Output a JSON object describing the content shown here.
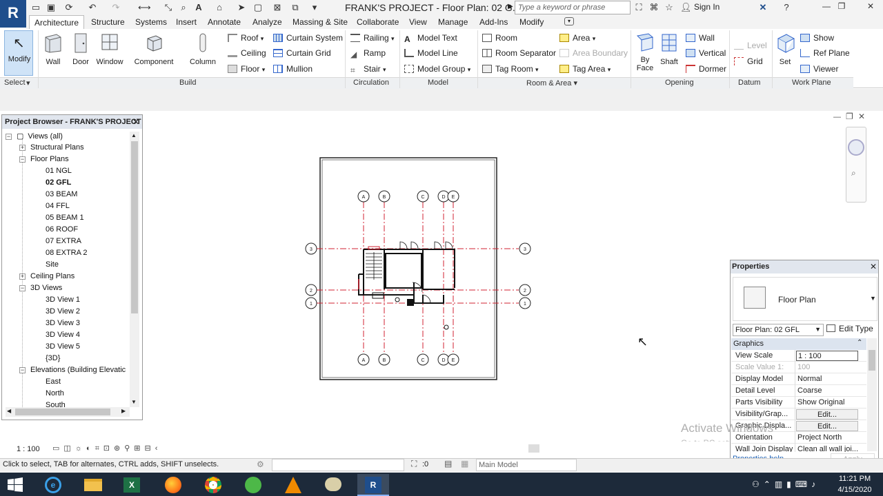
{
  "app": {
    "logo": "R",
    "doc_title": "FRANK'S PROJECT - Floor Plan: 02 G...",
    "search_placeholder": "Type a keyword or phrase",
    "sign_in": "Sign In"
  },
  "tabs": [
    "Architecture",
    "Structure",
    "Systems",
    "Insert",
    "Annotate",
    "Analyze",
    "Massing & Site",
    "Collaborate",
    "View",
    "Manage",
    "Add-Ins",
    "Modify"
  ],
  "ribbon": {
    "select": {
      "modify": "Modify",
      "panel": "Select"
    },
    "build": {
      "panel": "Build",
      "wall": "Wall",
      "door": "Door",
      "window": "Window",
      "component": "Component",
      "column": "Column",
      "roof": "Roof",
      "ceiling": "Ceiling",
      "floor": "Floor",
      "curtain_system": "Curtain System",
      "curtain_grid": "Curtain Grid",
      "mullion": "Mullion"
    },
    "circulation": {
      "panel": "Circulation",
      "railing": "Railing",
      "ramp": "Ramp",
      "stair": "Stair"
    },
    "model": {
      "panel": "Model",
      "model_text": "Model Text",
      "model_line": "Model Line",
      "model_group": "Model Group"
    },
    "room_area": {
      "panel": "Room & Area",
      "room": "Room",
      "room_separator": "Room Separator",
      "tag_room": "Tag Room",
      "area": "Area",
      "area_boundary": "Area Boundary",
      "tag_area": "Tag Area"
    },
    "opening": {
      "panel": "Opening",
      "by_face_1": "By",
      "by_face_2": "Face",
      "shaft": "Shaft",
      "wall": "Wall",
      "vertical": "Vertical",
      "dormer": "Dormer"
    },
    "datum": {
      "panel": "Datum",
      "level": "Level",
      "grid": "Grid"
    },
    "work_plane": {
      "panel": "Work Plane",
      "set": "Set",
      "show": "Show",
      "ref_plane": "Ref Plane",
      "viewer": "Viewer"
    }
  },
  "project_browser": {
    "title": "Project Browser - FRANK'S PROJECT",
    "items": [
      {
        "label": "Views (all)",
        "level": 0,
        "exp": "−"
      },
      {
        "label": "Structural Plans",
        "level": 1,
        "exp": "+"
      },
      {
        "label": "Floor Plans",
        "level": 1,
        "exp": "−"
      },
      {
        "label": "01 NGL",
        "level": 2
      },
      {
        "label": "02 GFL",
        "level": 2,
        "active": true
      },
      {
        "label": "03 BEAM",
        "level": 2
      },
      {
        "label": "04 FFL",
        "level": 2
      },
      {
        "label": "05 BEAM 1",
        "level": 2
      },
      {
        "label": "06 ROOF",
        "level": 2
      },
      {
        "label": "07 EXTRA",
        "level": 2
      },
      {
        "label": "08 EXTRA 2",
        "level": 2
      },
      {
        "label": "Site",
        "level": 2
      },
      {
        "label": "Ceiling Plans",
        "level": 1,
        "exp": "+"
      },
      {
        "label": "3D Views",
        "level": 1,
        "exp": "−"
      },
      {
        "label": "3D View 1",
        "level": 2
      },
      {
        "label": "3D View 2",
        "level": 2
      },
      {
        "label": "3D View 3",
        "level": 2
      },
      {
        "label": "3D View 4",
        "level": 2
      },
      {
        "label": "3D View 5",
        "level": 2
      },
      {
        "label": "{3D}",
        "level": 2
      },
      {
        "label": "Elevations (Building Elevatic",
        "level": 1,
        "exp": "−"
      },
      {
        "label": "East",
        "level": 2
      },
      {
        "label": "North",
        "level": 2
      },
      {
        "label": "South",
        "level": 2
      }
    ]
  },
  "grids": {
    "vertical": [
      "A",
      "B",
      "C",
      "D",
      "E"
    ],
    "horizontal": [
      "3",
      "2",
      "1"
    ]
  },
  "properties": {
    "title": "Properties",
    "family": "Floor Plan",
    "selector": "Floor Plan: 02 GFL",
    "edit_type": "Edit Type",
    "section": "Graphics",
    "rows": [
      {
        "name": "View Scale",
        "value": "1 : 100"
      },
      {
        "name": "Scale Value  1:",
        "value": "100"
      },
      {
        "name": "Display Model",
        "value": "Normal"
      },
      {
        "name": "Detail Level",
        "value": "Coarse"
      },
      {
        "name": "Parts Visibility",
        "value": "Show Original"
      },
      {
        "name": "Visibility/Grap...",
        "value": "Edit..."
      },
      {
        "name": "Graphic Displa...",
        "value": "Edit..."
      },
      {
        "name": "Orientation",
        "value": "Project North"
      },
      {
        "name": "Wall Join Display",
        "value": "Clean all wall joi..."
      }
    ],
    "help": "Properties help",
    "apply": "Apply"
  },
  "view_control": {
    "scale": "1 : 100"
  },
  "status": {
    "text": "Click to select, TAB for alternates, CTRL adds, SHIFT unselects.",
    "count": ":0",
    "model": "Main Model"
  },
  "watermark": {
    "line1": "Activate Windows",
    "line2": "Go to PC settings to activate Windows."
  },
  "taskbar": {
    "time": "11:21 PM",
    "date": "4/15/2020"
  },
  "colors": {
    "accent": "#1f4e8c",
    "grid_line": "#d02030",
    "taskbar": "#1d2a3a"
  }
}
